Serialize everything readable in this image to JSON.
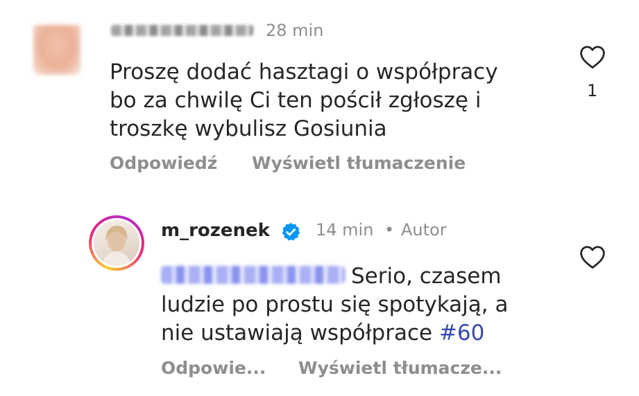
{
  "comments": [
    {
      "time": "28 min",
      "text_lines": [
        "Proszę dodać hasztagi o współpracy",
        "bo za chwilę Ci ten pościł zgłoszę i",
        "troszkę wybulisz Gosiunia"
      ],
      "actions": {
        "reply": "Odpowiedź",
        "translate": "Wyświetl tłumaczenie"
      },
      "like_icon": "heart-outline-icon",
      "like_count": "1"
    },
    {
      "username": "m_rozenek",
      "verified_icon": "verified-badge-icon",
      "time": "14 min",
      "separator": "•",
      "author_label": "Autor",
      "text_lines": [
        "Serio, czasem",
        "ludzie po prostu się spotykają, a",
        "nie ustawiają współprace"
      ],
      "hashtag": "#60",
      "actions": {
        "reply": "Odpowie...",
        "translate": "Wyświetl tłumacze..."
      },
      "like_icon": "heart-outline-icon"
    }
  ],
  "colors": {
    "text": "#262626",
    "muted": "#8e8e8e",
    "link": "#3949ab",
    "verified": "#0095f6"
  }
}
